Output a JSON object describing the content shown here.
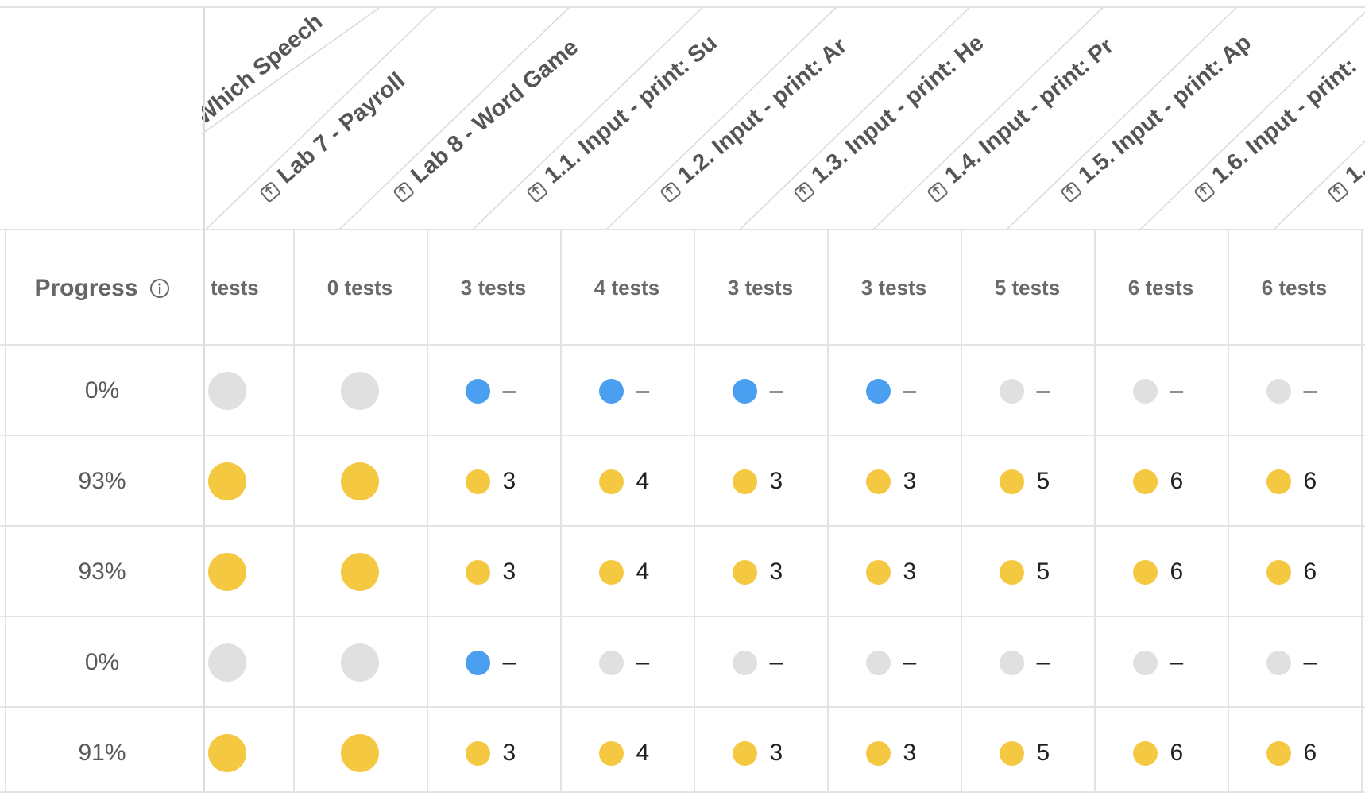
{
  "progress_header": {
    "label": "Progress",
    "info_icon": "info-icon"
  },
  "columns": [
    {
      "title": "Which Speech",
      "tests": "tests",
      "icon": "export-icon"
    },
    {
      "title": "Lab 7 - Payroll",
      "tests": "0 tests",
      "icon": "export-icon"
    },
    {
      "title": "Lab 8 - Word Game",
      "tests": "3 tests",
      "icon": "export-icon"
    },
    {
      "title": "1.1. Input - print: Su",
      "tests": "4 tests",
      "icon": "export-icon"
    },
    {
      "title": "1.2. Input - print: Ar",
      "tests": "3 tests",
      "icon": "export-icon"
    },
    {
      "title": "1.3. Input - print: He",
      "tests": "3 tests",
      "icon": "export-icon"
    },
    {
      "title": "1.4. Input - print: Pr",
      "tests": "5 tests",
      "icon": "export-icon"
    },
    {
      "title": "1.5. Input - print: Ap",
      "tests": "6 tests",
      "icon": "export-icon"
    },
    {
      "title": "1.6. Input - print:",
      "tests": "6 tests",
      "icon": "export-icon"
    },
    {
      "title": "1.",
      "tests": "",
      "icon": "export-icon"
    }
  ],
  "rows": [
    {
      "progress": "0%",
      "cells": [
        {
          "dot": "gray",
          "big": true,
          "val": ""
        },
        {
          "dot": "gray",
          "big": true,
          "val": ""
        },
        {
          "dot": "blue",
          "val": "–"
        },
        {
          "dot": "blue",
          "val": "–"
        },
        {
          "dot": "blue",
          "val": "–"
        },
        {
          "dot": "blue",
          "val": "–"
        },
        {
          "dot": "gray",
          "val": "–"
        },
        {
          "dot": "gray",
          "val": "–"
        },
        {
          "dot": "gray",
          "val": "–"
        }
      ]
    },
    {
      "progress": "93%",
      "cells": [
        {
          "dot": "yellow",
          "big": true,
          "val": ""
        },
        {
          "dot": "yellow",
          "big": true,
          "val": ""
        },
        {
          "dot": "yellow",
          "val": "3"
        },
        {
          "dot": "yellow",
          "val": "4"
        },
        {
          "dot": "yellow",
          "val": "3"
        },
        {
          "dot": "yellow",
          "val": "3"
        },
        {
          "dot": "yellow",
          "val": "5"
        },
        {
          "dot": "yellow",
          "val": "6"
        },
        {
          "dot": "yellow",
          "val": "6"
        }
      ]
    },
    {
      "progress": "93%",
      "cells": [
        {
          "dot": "yellow",
          "big": true,
          "val": ""
        },
        {
          "dot": "yellow",
          "big": true,
          "val": ""
        },
        {
          "dot": "yellow",
          "val": "3"
        },
        {
          "dot": "yellow",
          "val": "4"
        },
        {
          "dot": "yellow",
          "val": "3"
        },
        {
          "dot": "yellow",
          "val": "3"
        },
        {
          "dot": "yellow",
          "val": "5"
        },
        {
          "dot": "yellow",
          "val": "6"
        },
        {
          "dot": "yellow",
          "val": "6"
        }
      ]
    },
    {
      "progress": "0%",
      "cells": [
        {
          "dot": "gray",
          "big": true,
          "val": ""
        },
        {
          "dot": "gray",
          "big": true,
          "val": ""
        },
        {
          "dot": "blue",
          "val": "–"
        },
        {
          "dot": "gray",
          "val": "–"
        },
        {
          "dot": "gray",
          "val": "–"
        },
        {
          "dot": "gray",
          "val": "–"
        },
        {
          "dot": "gray",
          "val": "–"
        },
        {
          "dot": "gray",
          "val": "–"
        },
        {
          "dot": "gray",
          "val": "–"
        }
      ]
    },
    {
      "progress": "91%",
      "cells": [
        {
          "dot": "yellow",
          "big": true,
          "val": ""
        },
        {
          "dot": "yellow",
          "big": true,
          "val": ""
        },
        {
          "dot": "yellow",
          "val": "3"
        },
        {
          "dot": "yellow",
          "val": "4"
        },
        {
          "dot": "yellow",
          "val": "3"
        },
        {
          "dot": "yellow",
          "val": "3"
        },
        {
          "dot": "yellow",
          "val": "5"
        },
        {
          "dot": "yellow",
          "val": "6"
        },
        {
          "dot": "yellow",
          "val": "6"
        }
      ]
    }
  ],
  "colors": {
    "yellow": "#f5c842",
    "blue": "#4a9ff0",
    "gray": "#e0e0e0",
    "grid": "#e3e3e3",
    "header_text": "#555555"
  }
}
